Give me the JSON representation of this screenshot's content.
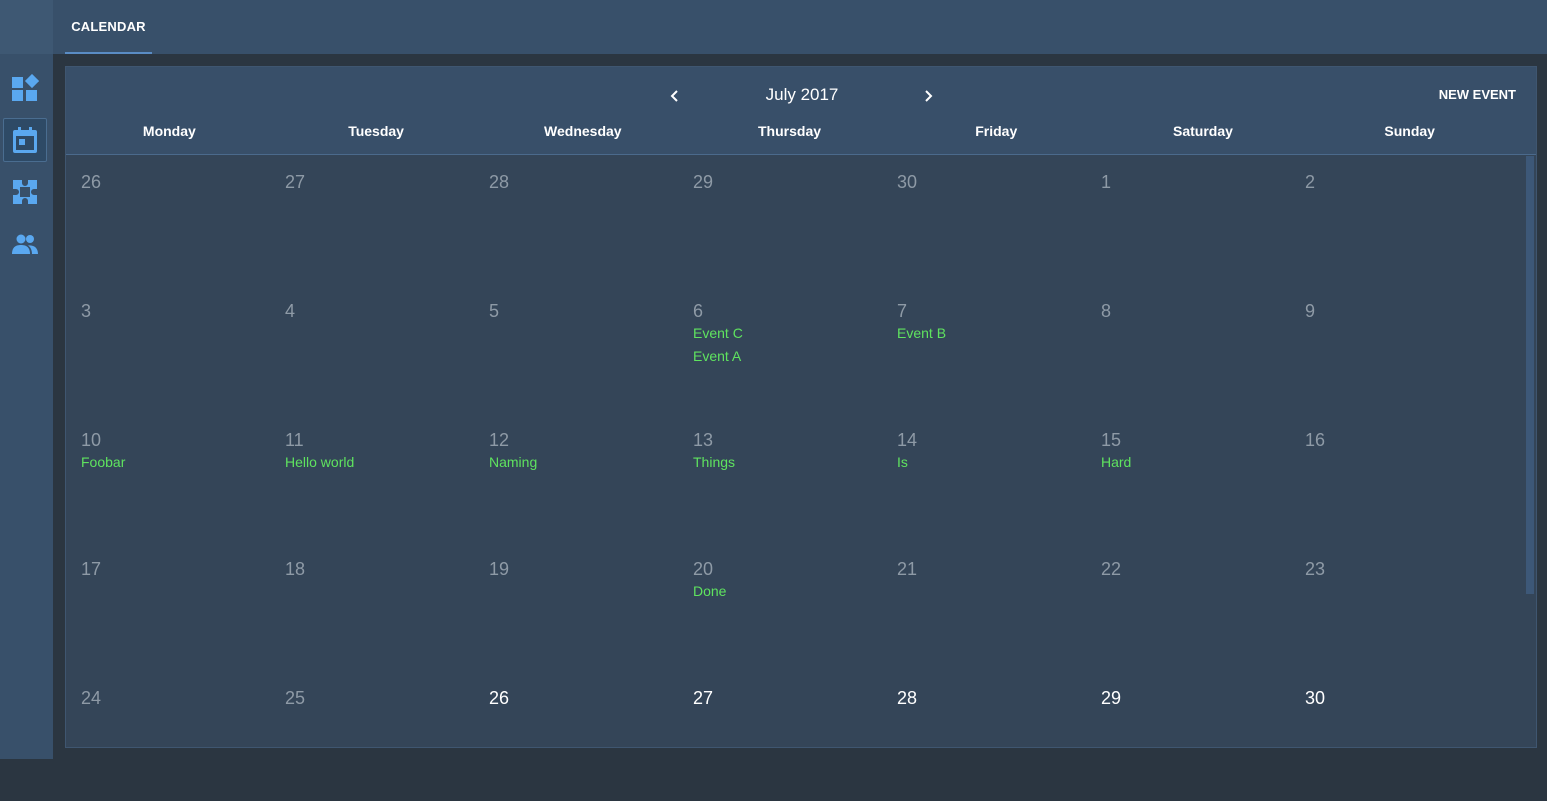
{
  "topbar": {
    "tab_label": "CALENDAR"
  },
  "sidebar": {
    "items": [
      {
        "name": "dashboard-icon",
        "active": false
      },
      {
        "name": "calendar-icon",
        "active": true
      },
      {
        "name": "puzzle-icon",
        "active": false
      },
      {
        "name": "people-icon",
        "active": false
      }
    ]
  },
  "calendar": {
    "month_label": "July 2017",
    "new_event_label": "NEW EVENT",
    "weekdays": [
      "Monday",
      "Tuesday",
      "Wednesday",
      "Thursday",
      "Friday",
      "Saturday",
      "Sunday"
    ],
    "weeks": [
      [
        {
          "day": "26",
          "current": false,
          "events": []
        },
        {
          "day": "27",
          "current": false,
          "events": []
        },
        {
          "day": "28",
          "current": false,
          "events": []
        },
        {
          "day": "29",
          "current": false,
          "events": []
        },
        {
          "day": "30",
          "current": false,
          "events": []
        },
        {
          "day": "1",
          "current": false,
          "events": []
        },
        {
          "day": "2",
          "current": false,
          "events": []
        }
      ],
      [
        {
          "day": "3",
          "current": false,
          "events": []
        },
        {
          "day": "4",
          "current": false,
          "events": []
        },
        {
          "day": "5",
          "current": false,
          "events": []
        },
        {
          "day": "6",
          "current": false,
          "events": [
            "Event C",
            "Event A"
          ]
        },
        {
          "day": "7",
          "current": false,
          "events": [
            "Event B"
          ]
        },
        {
          "day": "8",
          "current": false,
          "events": []
        },
        {
          "day": "9",
          "current": false,
          "events": []
        }
      ],
      [
        {
          "day": "10",
          "current": false,
          "events": [
            "Foobar"
          ]
        },
        {
          "day": "11",
          "current": false,
          "events": [
            "Hello world"
          ]
        },
        {
          "day": "12",
          "current": false,
          "events": [
            "Naming"
          ]
        },
        {
          "day": "13",
          "current": false,
          "events": [
            "Things"
          ]
        },
        {
          "day": "14",
          "current": false,
          "events": [
            "Is"
          ]
        },
        {
          "day": "15",
          "current": false,
          "events": [
            "Hard"
          ]
        },
        {
          "day": "16",
          "current": false,
          "events": []
        }
      ],
      [
        {
          "day": "17",
          "current": false,
          "events": []
        },
        {
          "day": "18",
          "current": false,
          "events": []
        },
        {
          "day": "19",
          "current": false,
          "events": []
        },
        {
          "day": "20",
          "current": false,
          "events": [
            "Done"
          ]
        },
        {
          "day": "21",
          "current": false,
          "events": []
        },
        {
          "day": "22",
          "current": false,
          "events": []
        },
        {
          "day": "23",
          "current": false,
          "events": []
        }
      ],
      [
        {
          "day": "24",
          "current": false,
          "events": []
        },
        {
          "day": "25",
          "current": false,
          "events": []
        },
        {
          "day": "26",
          "current": true,
          "events": []
        },
        {
          "day": "27",
          "current": true,
          "events": []
        },
        {
          "day": "28",
          "current": true,
          "events": []
        },
        {
          "day": "29",
          "current": true,
          "events": []
        },
        {
          "day": "30",
          "current": true,
          "events": []
        }
      ]
    ]
  },
  "colors": {
    "event_text": "#5fe35f",
    "accent_blue": "#5aa8f0",
    "muted_day": "#8e9aa6"
  }
}
